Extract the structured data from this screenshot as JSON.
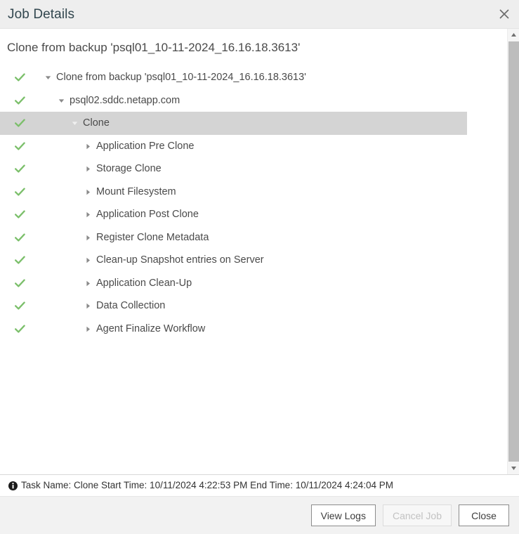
{
  "dialog": {
    "title": "Job Details",
    "close_icon": "close-icon",
    "subtitle": "Clone from backup 'psql01_10-11-2024_16.16.18.3613'"
  },
  "colors": {
    "title_text": "#32474f",
    "success_check": "#7bbf6a",
    "selected_row": "#d4d4d4",
    "titlebar_bg": "#eeeeee",
    "footer_bg": "#f2f2f2",
    "tree_text": "#4a4a4a",
    "scrollbar_thumb": "#bdbdbd"
  },
  "tree": [
    {
      "label": "Clone from backup 'psql01_10-11-2024_16.16.18.3613'",
      "level": 0,
      "status": "success",
      "expanded": true,
      "selected": false
    },
    {
      "label": "psql02.sddc.netapp.com",
      "level": 1,
      "status": "success",
      "expanded": true,
      "selected": false
    },
    {
      "label": "Clone",
      "level": 2,
      "status": "success",
      "expanded": true,
      "selected": true
    },
    {
      "label": "Application Pre Clone",
      "level": 3,
      "status": "success",
      "expanded": false,
      "selected": false
    },
    {
      "label": "Storage Clone",
      "level": 3,
      "status": "success",
      "expanded": false,
      "selected": false
    },
    {
      "label": "Mount Filesystem",
      "level": 3,
      "status": "success",
      "expanded": false,
      "selected": false
    },
    {
      "label": "Application Post Clone",
      "level": 3,
      "status": "success",
      "expanded": false,
      "selected": false
    },
    {
      "label": "Register Clone Metadata",
      "level": 3,
      "status": "success",
      "expanded": false,
      "selected": false
    },
    {
      "label": "Clean-up Snapshot entries on Server",
      "level": 3,
      "status": "success",
      "expanded": false,
      "selected": false
    },
    {
      "label": "Application Clean-Up",
      "level": 3,
      "status": "success",
      "expanded": false,
      "selected": false
    },
    {
      "label": "Data Collection",
      "level": 3,
      "status": "success",
      "expanded": false,
      "selected": false
    },
    {
      "label": "Agent Finalize Workflow",
      "level": 3,
      "status": "success",
      "expanded": false,
      "selected": false
    }
  ],
  "statusbar": {
    "icon": "info-icon",
    "text": "Task Name: Clone Start Time: 10/11/2024 4:22:53 PM End Time: 10/11/2024 4:24:04 PM"
  },
  "scrollbar": {
    "up_icon": "caret-up-icon",
    "down_icon": "caret-down-icon"
  },
  "footer": {
    "view_logs_label": "View Logs",
    "cancel_job_label": "Cancel Job",
    "close_label": "Close"
  }
}
